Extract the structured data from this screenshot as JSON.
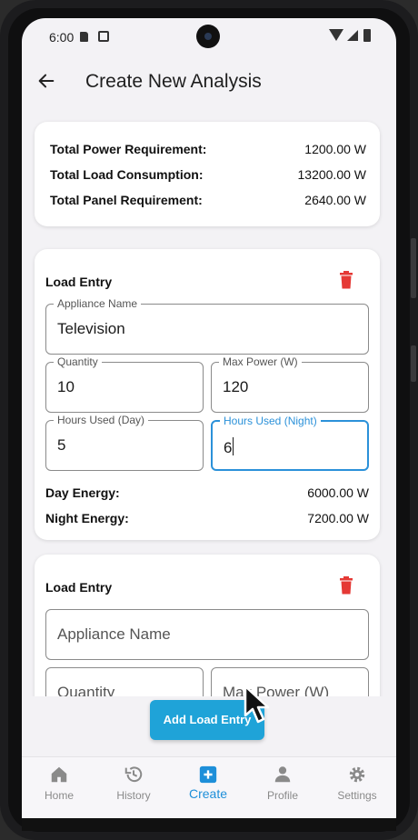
{
  "status_bar": {
    "time": "6:00"
  },
  "app_bar": {
    "title": "Create New Analysis",
    "back_icon": "arrow-left-icon"
  },
  "summary": {
    "rows": [
      {
        "label": "Total Power Requirement:",
        "value": "1200.00 W"
      },
      {
        "label": "Total Load Consumption:",
        "value": "13200.00 W"
      },
      {
        "label": "Total Panel Requirement:",
        "value": "2640.00 W"
      }
    ]
  },
  "load_entries": [
    {
      "title": "Load Entry",
      "appliance_name": {
        "label": "Appliance Name",
        "value": "Television"
      },
      "quantity": {
        "label": "Quantity",
        "value": "10"
      },
      "max_power": {
        "label": "Max Power (W)",
        "value": "120"
      },
      "hours_day": {
        "label": "Hours Used (Day)",
        "value": "5"
      },
      "hours_night": {
        "label": "Hours Used (Night)",
        "value": "6"
      },
      "day_energy": {
        "label": "Day Energy:",
        "value": "6000.00 W"
      },
      "night_energy": {
        "label": "Night Energy:",
        "value": "7200.00 W"
      }
    },
    {
      "title": "Load Entry",
      "appliance_name": {
        "placeholder": "Appliance Name"
      },
      "quantity": {
        "placeholder": "Quantity"
      },
      "max_power": {
        "placeholder": "Max Power (W)"
      }
    }
  ],
  "add_button": {
    "label": "Add Load Entry"
  },
  "bottom_nav": {
    "items": [
      {
        "label": "Home",
        "icon": "home-icon"
      },
      {
        "label": "History",
        "icon": "history-icon"
      },
      {
        "label": "Create",
        "icon": "add-box-icon",
        "active": true
      },
      {
        "label": "Profile",
        "icon": "person-icon"
      },
      {
        "label": "Settings",
        "icon": "gear-icon"
      }
    ]
  },
  "colors": {
    "accent": "#2b91d9",
    "button": "#1fa3d8",
    "delete": "#e53935",
    "nav_active": "#1e8fd9",
    "background": "#f3f2f5"
  }
}
